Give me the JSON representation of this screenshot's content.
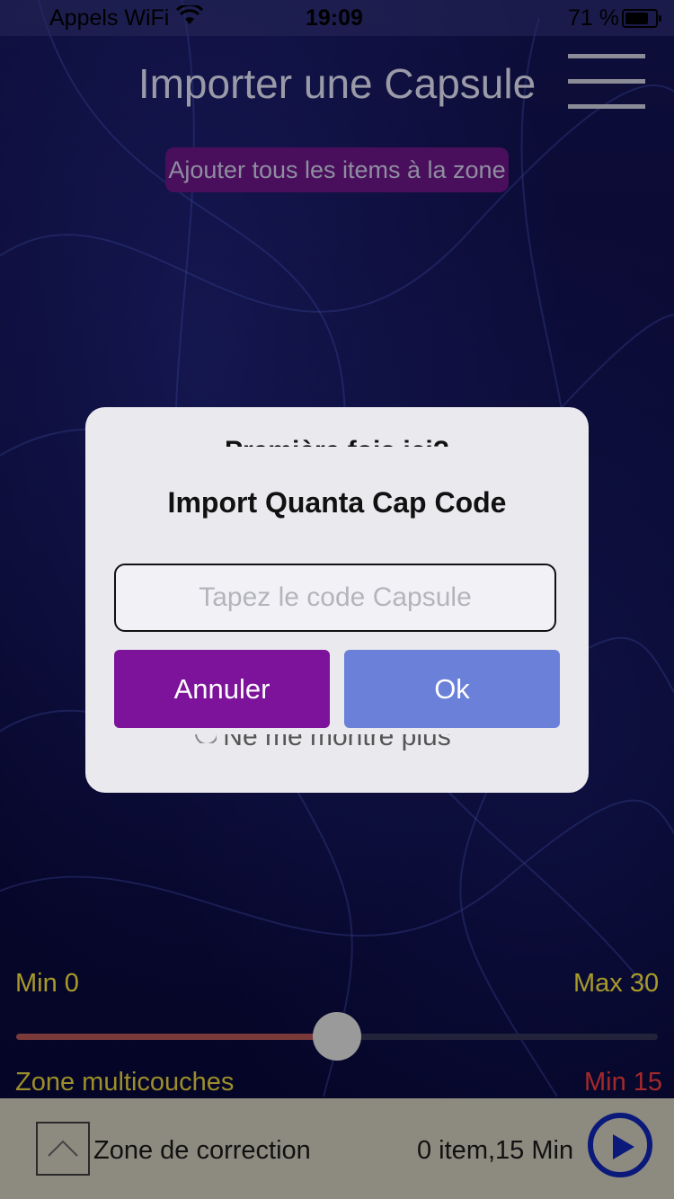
{
  "status_bar": {
    "carrier": "Appels WiFi",
    "time": "19:09",
    "battery_percent": "71 %"
  },
  "header": {
    "title": "Importer une Capsule",
    "menu_icon": "hamburger-menu-icon"
  },
  "actions": {
    "add_all_label": "Ajouter tous les items à la zone"
  },
  "behind_dialog": {
    "heading_fragment": "Première fois ici?",
    "option_fragment": "Ne me montre plus"
  },
  "dialog": {
    "title": "Import Quanta Cap Code",
    "input_placeholder": "Tapez le code Capsule",
    "input_value": "",
    "cancel_label": "Annuler",
    "ok_label": "Ok",
    "cancel_color": "#7c139a",
    "ok_color": "#6b80d8"
  },
  "slider": {
    "min_label": "Min 0",
    "max_label": "Max 30",
    "min": 0,
    "max": 30,
    "value": 15
  },
  "zone": {
    "label": "Zone multicouches",
    "min_label": "Min 15"
  },
  "bottom_bar": {
    "correction_label": "Zone de correction",
    "info": "0 item,15 Min",
    "expand_icon": "chevron-up-icon",
    "play_icon": "play-icon"
  }
}
